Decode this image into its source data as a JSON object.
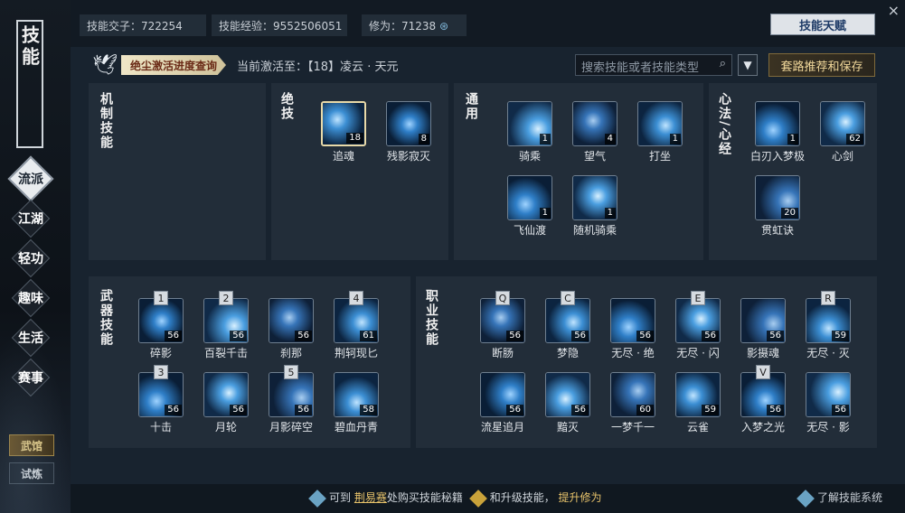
{
  "sidebar": {
    "title": "技能",
    "nav": [
      "流派",
      "江湖",
      "轻功",
      "趣味",
      "生活",
      "赛事"
    ],
    "bottom": [
      "武馆",
      "试炼"
    ]
  },
  "header": {
    "coin_label": "技能交子：722254",
    "exp_label": "技能经验：9552506051",
    "cultivation_label": "修为：71238",
    "talent_button": "技能天赋",
    "close": "×"
  },
  "progress": {
    "tag": "绝尘激活进度查询",
    "current": "当前激活至：【18】凌云 · 天元"
  },
  "search": {
    "placeholder": "搜索技能或者技能类型"
  },
  "save_button": "套路推荐和保存",
  "sections": {
    "mechanic": "机制技能",
    "ultimate": "绝技",
    "general": "通用",
    "xinfa": "心法/心经",
    "weapon": "武器技能",
    "class": "职业技能"
  },
  "ultimate_skills": [
    {
      "name": "追魂",
      "level": "18",
      "selected": true
    },
    {
      "name": "残影寂灭",
      "level": "8"
    }
  ],
  "general_skills": [
    {
      "name": "骑乘",
      "level": "1"
    },
    {
      "name": "望气",
      "level": "4"
    },
    {
      "name": "打坐",
      "level": "1"
    },
    {
      "name": "飞仙渡",
      "level": "1"
    },
    {
      "name": "随机骑乘",
      "level": "1"
    }
  ],
  "xinfa_skills": [
    {
      "name": "白刃入梦极",
      "level": "1"
    },
    {
      "name": "心剑",
      "level": "62"
    },
    {
      "name": "贯虹诀",
      "level": "20"
    }
  ],
  "weapon_skills": [
    {
      "name": "碎影",
      "level": "56",
      "key": "1"
    },
    {
      "name": "百裂千击",
      "level": "56",
      "key": "2"
    },
    {
      "name": "刹那",
      "level": "56",
      "key": ""
    },
    {
      "name": "荆轲现匕",
      "level": "61",
      "key": "4"
    },
    {
      "name": "十击",
      "level": "56",
      "key": "3"
    },
    {
      "name": "月轮",
      "level": "56",
      "key": ""
    },
    {
      "name": "月影碎空",
      "level": "56",
      "key": "5"
    },
    {
      "name": "碧血丹青",
      "level": "58",
      "key": ""
    }
  ],
  "class_skills": [
    {
      "name": "断肠",
      "level": "56",
      "key": "Q"
    },
    {
      "name": "梦隐",
      "level": "56",
      "key": "C"
    },
    {
      "name": "无尽 · 绝",
      "level": "56",
      "key": ""
    },
    {
      "name": "无尽 · 闪",
      "level": "56",
      "key": "E"
    },
    {
      "name": "影摄魂",
      "level": "56",
      "key": ""
    },
    {
      "name": "无尽 · 灭",
      "level": "59",
      "key": "R"
    },
    {
      "name": "流星追月",
      "level": "56",
      "key": ""
    },
    {
      "name": "黯灭",
      "level": "56",
      "key": ""
    },
    {
      "name": "一梦千一",
      "level": "60",
      "key": ""
    },
    {
      "name": "云雀",
      "level": "59",
      "key": ""
    },
    {
      "name": "入梦之光",
      "level": "56",
      "key": "V"
    },
    {
      "name": "无尽 · 影",
      "level": "56",
      "key": ""
    }
  ],
  "footer": {
    "hint1": "可到",
    "hint_link": "荆易赛",
    "hint2": "处购买技能秘籍",
    "hint3": "和升级技能，",
    "hint4": "提升修为",
    "help": "了解技能系统"
  },
  "colors": {
    "accent_gold": "#e8c36b",
    "panel": "#222d39",
    "icon_blue": "#3b8ed0"
  }
}
